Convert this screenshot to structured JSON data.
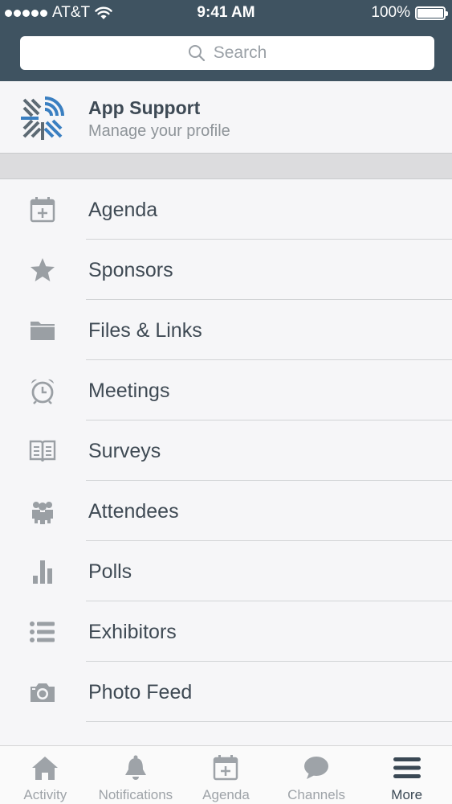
{
  "status_bar": {
    "carrier": "AT&T",
    "time": "9:41 AM",
    "battery": "100%",
    "signal_icon": "signal-dots-icon",
    "wifi_icon": "wifi-icon",
    "battery_icon": "battery-icon"
  },
  "search": {
    "placeholder": "Search",
    "icon": "search-icon"
  },
  "profile": {
    "name": "App Support",
    "subtitle": "Manage your profile",
    "logo": "app-support-logo"
  },
  "menu": {
    "items": [
      {
        "label": "Agenda",
        "icon": "calendar-icon"
      },
      {
        "label": "Sponsors",
        "icon": "star-icon"
      },
      {
        "label": "Files & Links",
        "icon": "folder-icon"
      },
      {
        "label": "Meetings",
        "icon": "alarm-clock-icon"
      },
      {
        "label": "Surveys",
        "icon": "book-icon"
      },
      {
        "label": "Attendees",
        "icon": "people-icon"
      },
      {
        "label": "Polls",
        "icon": "bar-chart-icon"
      },
      {
        "label": "Exhibitors",
        "icon": "list-icon"
      },
      {
        "label": "Photo Feed",
        "icon": "camera-icon"
      }
    ]
  },
  "tab_bar": {
    "tabs": [
      {
        "label": "Activity",
        "icon": "home-icon",
        "active": false
      },
      {
        "label": "Notifications",
        "icon": "bell-icon",
        "active": false
      },
      {
        "label": "Agenda",
        "icon": "calendar-icon",
        "active": false
      },
      {
        "label": "Channels",
        "icon": "chat-bubble-icon",
        "active": false
      },
      {
        "label": "More",
        "icon": "hamburger-menu-icon",
        "active": true
      }
    ]
  },
  "colors": {
    "header_bg": "#3f5361",
    "icon_gray": "#9a9fa4",
    "logo_blue": "#3a7fc1",
    "logo_gray": "#5d6a74",
    "active_tab": "#3a4854"
  }
}
